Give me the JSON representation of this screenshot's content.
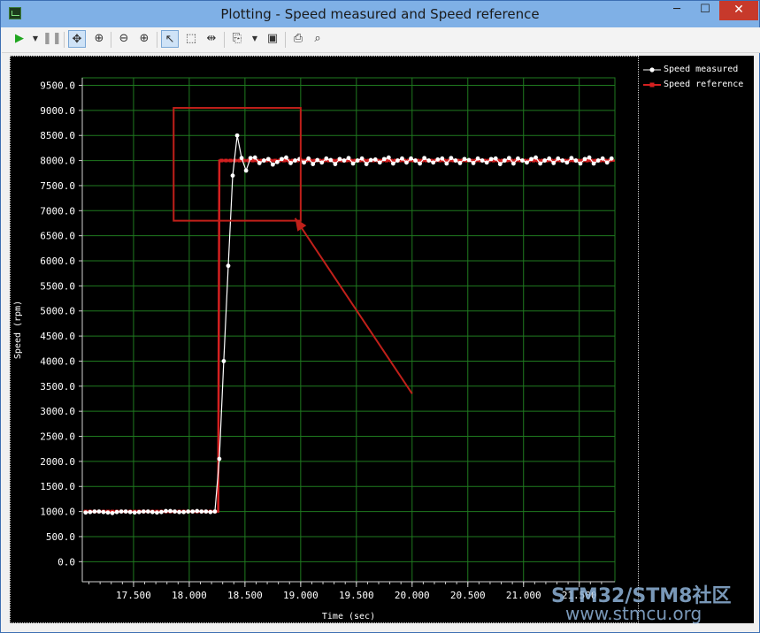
{
  "window": {
    "title": "Plotting  - Speed measured and Speed reference"
  },
  "titlebar": {
    "minimize_glyph": "─",
    "maximize_glyph": "☐",
    "close_glyph": "✕"
  },
  "toolbar": {
    "icons": [
      "play-icon",
      "dropdown-arrow-icon",
      "pause-icon",
      "pan-icon",
      "zoom-fit-icon",
      "zoom-out-icon",
      "zoom-in-icon",
      "pointer-icon",
      "rect-select-icon",
      "split-icon",
      "copy-icon",
      "dropdown-arrow-icon",
      "save-icon",
      "print-icon",
      "print-preview-icon"
    ]
  },
  "legend": [
    {
      "label": "Speed measured",
      "color": "#ffffff"
    },
    {
      "label": "Speed reference",
      "color": "#d42020"
    }
  ],
  "watermark": {
    "line1": "STM32/STM8社区",
    "line2": "www.stmcu.org"
  },
  "colors": {
    "grid": "#1f7a1f",
    "plot_bg": "#000000",
    "reference": "#d42020",
    "measured": "#ffffff",
    "annotation": "#c0201a"
  },
  "chart_data": {
    "type": "line",
    "xlabel": "Time (sec)",
    "ylabel": "Speed (rpm)",
    "xlim": [
      17.04,
      21.82
    ],
    "ylim": [
      -0.9,
      0.9
    ],
    "x_ticks": [
      17.5,
      18.0,
      18.5,
      19.0,
      19.5,
      20.0,
      20.5,
      21.0,
      21.5
    ],
    "x_tick_labels": [
      "17.500",
      "18.000",
      "18.500",
      "19.000",
      "19.500",
      "20.000",
      "20.500",
      "21.000",
      "21.500"
    ],
    "y_ticks": [
      0,
      500,
      1000,
      1500,
      2000,
      2500,
      3000,
      3500,
      4000,
      4500,
      5000,
      5500,
      6000,
      6500,
      7000,
      7500,
      8000,
      8500,
      9000,
      9500
    ],
    "y_tick_labels": [
      "0.0",
      "500.0",
      "1000.0",
      "1500.0",
      "2000.0",
      "2500.0",
      "3000.0",
      "3500.0",
      "4000.0",
      "4500.0",
      "5000.0",
      "5500.0",
      "6000.0",
      "6500.0",
      "7000.0",
      "7500.0",
      "8000.0",
      "8500.0",
      "9000.0",
      "9500.0"
    ],
    "y_range": [
      -400,
      9650
    ],
    "grid": true,
    "legend_position": "right",
    "series": [
      {
        "name": "Speed reference",
        "x": [
          17.05,
          18.26,
          18.27,
          18.28,
          21.82
        ],
        "y": [
          1000,
          1000,
          8000,
          8000,
          8000
        ]
      },
      {
        "name": "Speed measured",
        "x": [
          17.07,
          17.11,
          17.15,
          17.19,
          17.23,
          17.27,
          17.31,
          17.35,
          17.39,
          17.43,
          17.47,
          17.51,
          17.55,
          17.59,
          17.63,
          17.67,
          17.71,
          17.75,
          17.79,
          17.83,
          17.87,
          17.91,
          17.95,
          17.99,
          18.03,
          18.07,
          18.11,
          18.15,
          18.19,
          18.23,
          18.27,
          18.31,
          18.35,
          18.39,
          18.43,
          18.47,
          18.51,
          18.55,
          18.59,
          18.63,
          18.67,
          18.71,
          18.75,
          18.79,
          18.83,
          18.87,
          18.91,
          18.95,
          18.99,
          19.03,
          19.07,
          19.11,
          19.15,
          19.19,
          19.23,
          19.27,
          19.31,
          19.35,
          19.39,
          19.43,
          19.47,
          19.51,
          19.55,
          19.59,
          19.63,
          19.67,
          19.71,
          19.75,
          19.79,
          19.83,
          19.87,
          19.91,
          19.95,
          19.99,
          20.03,
          20.07,
          20.11,
          20.15,
          20.19,
          20.23,
          20.27,
          20.31,
          20.35,
          20.39,
          20.43,
          20.47,
          20.51,
          20.55,
          20.59,
          20.63,
          20.67,
          20.71,
          20.75,
          20.79,
          20.83,
          20.87,
          20.91,
          20.95,
          20.99,
          21.03,
          21.07,
          21.11,
          21.15,
          21.19,
          21.23,
          21.27,
          21.31,
          21.35,
          21.39,
          21.43,
          21.47,
          21.51,
          21.55,
          21.59,
          21.63,
          21.67,
          21.71,
          21.75,
          21.79
        ],
        "y": [
          980,
          990,
          1000,
          1000,
          990,
          980,
          970,
          990,
          1000,
          1000,
          990,
          980,
          990,
          1000,
          1000,
          990,
          980,
          990,
          1010,
          1010,
          1000,
          990,
          990,
          1000,
          1000,
          1010,
          1000,
          1000,
          990,
          1000,
          2050,
          4000,
          5900,
          7700,
          8500,
          8050,
          7800,
          8050,
          8060,
          7950,
          8000,
          8030,
          7920,
          7970,
          8030,
          8060,
          7950,
          8000,
          8030,
          7960,
          8040,
          7930,
          8010,
          7960,
          8040,
          8010,
          7930,
          8030,
          8000,
          8050,
          7940,
          8000,
          8040,
          7930,
          8010,
          8020,
          7960,
          8030,
          8060,
          7940,
          8000,
          8040,
          7960,
          8040,
          8000,
          7940,
          8050,
          8000,
          7960,
          8020,
          8040,
          7940,
          8050,
          8000,
          7950,
          8030,
          8010,
          7950,
          8040,
          8000,
          7960,
          8030,
          8040,
          7930,
          8000,
          8050,
          7940,
          8040,
          8000,
          7960,
          8030,
          8060,
          7940,
          8000,
          8040,
          7950,
          8040,
          8000,
          7960,
          8050,
          8000,
          7940,
          8030,
          8060,
          7940,
          8000,
          8040,
          7960,
          8040
        ]
      }
    ],
    "annotations": [
      {
        "type": "rectangle",
        "x": [
          17.86,
          19.0
        ],
        "y": [
          6800,
          9050
        ]
      },
      {
        "type": "arrow",
        "from": [
          20.0,
          3350
        ],
        "to": [
          18.95,
          6850
        ]
      }
    ]
  }
}
